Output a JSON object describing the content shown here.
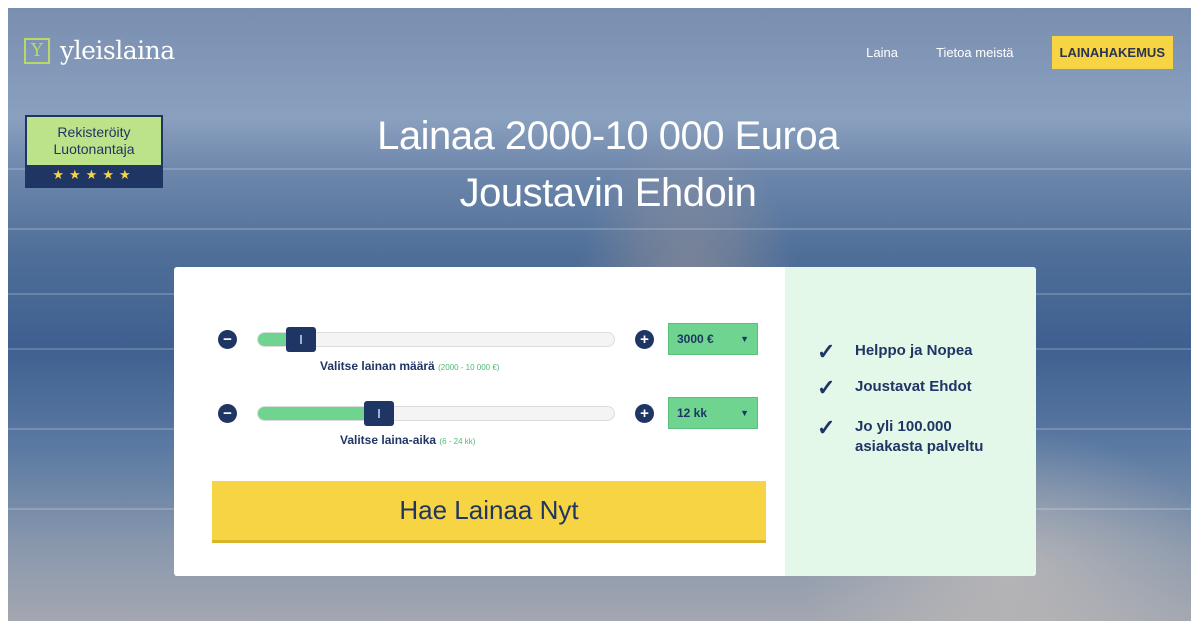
{
  "brand": {
    "logo_letter": "Y",
    "name": "yleislaina"
  },
  "nav": {
    "links": [
      "Laina",
      "Tietoa meistä"
    ],
    "cta": "LAINAHAKEMUS"
  },
  "badge": {
    "line1": "Rekisteröity",
    "line2": "Luotonantaja",
    "stars": "★★★★★"
  },
  "hero": {
    "line1": "Lainaa 2000-10 000 Euroa",
    "line2": "Joustavin Ehdoin"
  },
  "amount_slider": {
    "minus": "−",
    "plus": "+",
    "level_fraction": 0.12,
    "selected": "3000 €",
    "caption": "Valitse lainan määrä",
    "range": "(2000 - 10 000 €)"
  },
  "term_slider": {
    "minus": "−",
    "plus": "+",
    "level_fraction": 0.34,
    "selected": "12 kk",
    "caption": "Valitse laina-aika",
    "range": "(6 - 24 kk)"
  },
  "apply_button": "Hae Lainaa Nyt",
  "features": [
    {
      "check": "✓",
      "text": "Helppo ja Nopea"
    },
    {
      "check": "✓",
      "text": "Joustavat Ehdot"
    },
    {
      "check": "✓",
      "text": "Jo yli 100.000\nasiakasta palveltu"
    }
  ],
  "colors": {
    "brand_navy": "#1f3563",
    "accent_yellow": "#f6d443",
    "accent_green": "#6fd490",
    "panel_green": "#e4f8e9"
  }
}
